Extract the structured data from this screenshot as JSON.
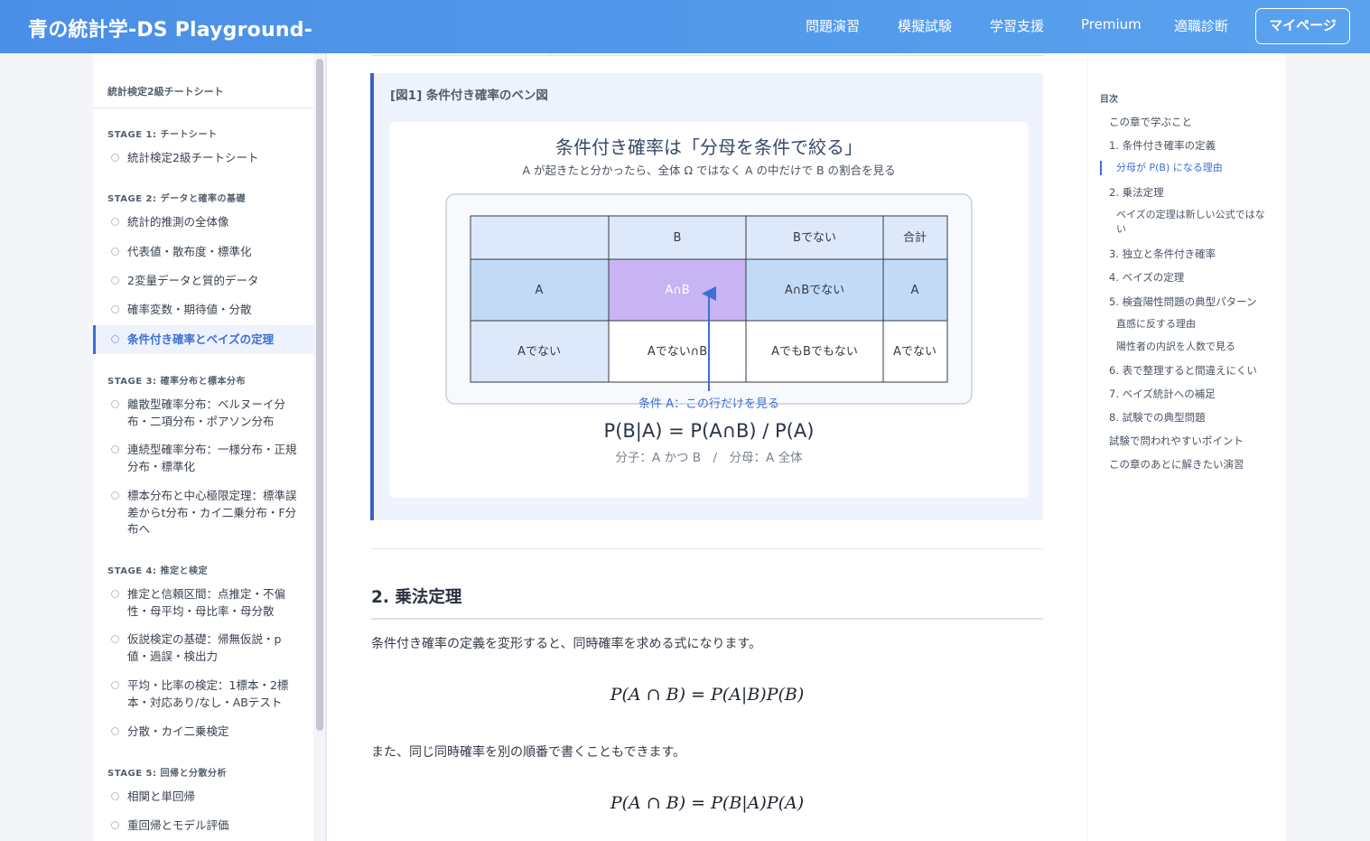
{
  "header": {
    "brand": "青の統計学-DS Playground-",
    "nav": [
      "問題演習",
      "模擬試験",
      "学習支援",
      "Premium",
      "適職診断"
    ],
    "mypage": "マイページ"
  },
  "sidebar": {
    "title": "統計検定2級チートシート",
    "stages": [
      {
        "label": "STAGE 1: チートシート",
        "items": [
          "統計検定2級チートシート"
        ]
      },
      {
        "label": "STAGE 2: データと確率の基礎",
        "items": [
          "統計的推測の全体像",
          "代表値・散布度・標準化",
          "2変量データと質的データ",
          "確率変数・期待値・分散",
          "条件付き確率とベイズの定理"
        ]
      },
      {
        "label": "STAGE 3: 確率分布と標本分布",
        "items": [
          "離散型確率分布：ベルヌーイ分布・二項分布・ポアソン分布",
          "連続型確率分布：一様分布・正規分布・標準化",
          "標本分布と中心極限定理：標準誤差からt分布・カイ二乗分布・F分布へ"
        ]
      },
      {
        "label": "STAGE 4: 推定と検定",
        "items": [
          "推定と信頼区間：点推定・不偏性・母平均・母比率・母分散",
          "仮説検定の基礎：帰無仮説・p値・過誤・検出力",
          "平均・比率の検定：1標本・2標本・対応あり/なし・ABテスト",
          "分散・カイ二乗検定"
        ]
      },
      {
        "label": "STAGE 5: 回帰と分散分析",
        "items": [
          "相関と単回帰",
          "重回帰とモデル評価"
        ]
      }
    ],
    "active_item": "条件付き確率とベイズの定理"
  },
  "figure": {
    "caption": "[図1] 条件付き確率のベン図",
    "title": "条件付き確率は「分母を条件で絞る」",
    "subtitle": "A が起きたと分かったら、全体 Ω ではなく A の中だけで B の割合を見る",
    "table": {
      "header": [
        "",
        "B",
        "Bでない",
        "合計"
      ],
      "rows": [
        [
          "A",
          "A∩B",
          "A∩Bでない",
          "A"
        ],
        [
          "Aでない",
          "Aでない∩B",
          "AでもBでもない",
          "Aでない"
        ]
      ]
    },
    "annotation": "条件 A：この行だけを見る",
    "formula": "P(B|A) = P(A∩B) / P(A)",
    "note": "分子：A かつ B　/　分母：A 全体",
    "colors": {
      "header": "#dde9fa",
      "row_a": "#c3daf7",
      "highlight": "#c8b4f2",
      "arrow": "#3d6fd6"
    }
  },
  "section2": {
    "heading": "2. 乗法定理",
    "para1": "条件付き確率の定義を変形すると、同時確率を求める式になります。",
    "math1": "P(A ∩ B) = P(A|B)P(B)",
    "para2": "また、同じ同時確率を別の順番で書くこともできます。",
    "math2": "P(A ∩ B) = P(B|A)P(A)"
  },
  "toc": {
    "title": "目次",
    "items": [
      {
        "label": "この章で学ぶこと",
        "level": 1
      },
      {
        "label": "1. 条件付き確率の定義",
        "level": 1
      },
      {
        "label": "分母が P(B) になる理由",
        "level": 2,
        "active": true
      },
      {
        "label": "2. 乗法定理",
        "level": 1
      },
      {
        "label": "ベイズの定理は新しい公式ではない",
        "level": 2
      },
      {
        "label": "3. 独立と条件付き確率",
        "level": 1
      },
      {
        "label": "4. ベイズの定理",
        "level": 1
      },
      {
        "label": "5. 検査陽性問題の典型パターン",
        "level": 1
      },
      {
        "label": "直感に反する理由",
        "level": 2
      },
      {
        "label": "陽性者の内訳を人数で見る",
        "level": 2
      },
      {
        "label": "6. 表で整理すると間違えにくい",
        "level": 1
      },
      {
        "label": "7. ベイズ統計への補足",
        "level": 1
      },
      {
        "label": "8. 試験での典型問題",
        "level": 1
      },
      {
        "label": "試験で問われやすいポイント",
        "level": 1
      },
      {
        "label": "この章のあとに解きたい演習",
        "level": 1
      }
    ]
  }
}
